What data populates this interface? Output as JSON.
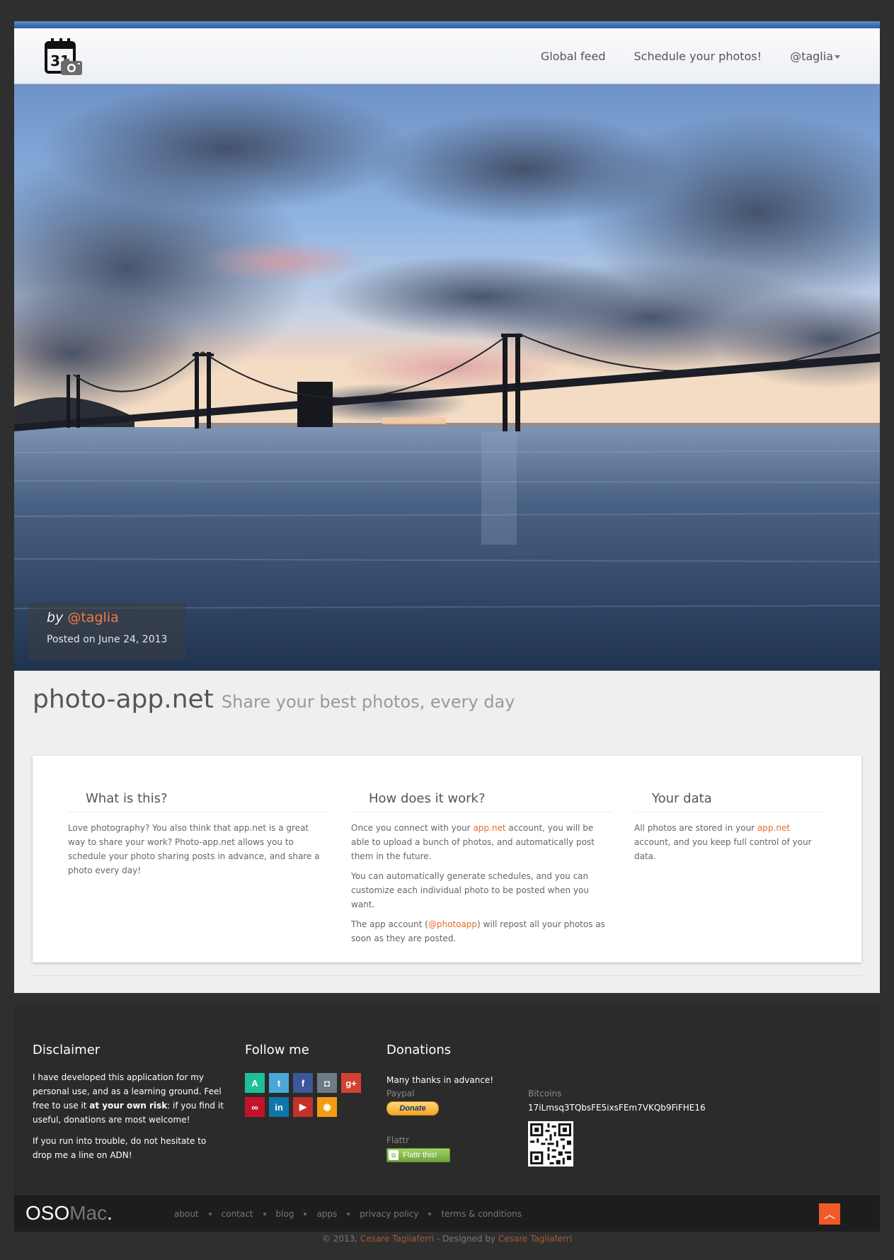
{
  "nav": {
    "items": [
      "Global feed",
      "Schedule your photos!",
      "@taglia"
    ]
  },
  "hero": {
    "by": "by",
    "author": "@taglia",
    "posted": "Posted on June 24, 2013"
  },
  "main": {
    "title": "photo-app.net",
    "tagline": "Share your best photos, every day",
    "columns": [
      {
        "title": "What is this?",
        "p1": "Love photography? You also think that app.net is a great way to share your work? Photo-app.net allows you to schedule your photo sharing posts in advance, and share a photo every day!"
      },
      {
        "title": "How does it work?",
        "p1a": "Once you connect with your ",
        "p1link": "app.net",
        "p1b": " account, you will be able to upload a bunch of photos, and automatically post them in the future.",
        "p2": "You can automatically generate schedules, and you can customize each individual photo to be posted when you want.",
        "p3a": "The app account (",
        "p3link": "@photoapp",
        "p3b": ") will repost all your photos as soon as they are posted."
      },
      {
        "title": "Your data",
        "p1a": "All photos are stored in your ",
        "p1link": "app.net",
        "p1b": " account, and you keep full control of your data."
      }
    ]
  },
  "footer": {
    "disclaimer": {
      "title": "Disclaimer",
      "p1a": "I have developed this application for my personal use, and as a learning ground. Feel free to use it ",
      "p1bold": "at your own risk",
      "p1b": ": if you find it useful, donations are most welcome!",
      "p2": "If you run into trouble, do not hesitate to drop me a line on ADN!"
    },
    "follow": {
      "title": "Follow me",
      "icons": [
        {
          "name": "adn-icon",
          "glyph": "A",
          "color": "#1fbf9a"
        },
        {
          "name": "twitter-icon",
          "glyph": "t",
          "color": "#4aa8d8"
        },
        {
          "name": "facebook-icon",
          "glyph": "f",
          "color": "#3b5998"
        },
        {
          "name": "github-icon",
          "glyph": "◘",
          "color": "#6e7b85"
        },
        {
          "name": "googleplus-icon",
          "glyph": "g+",
          "color": "#d44132"
        },
        {
          "name": "lastfm-icon",
          "glyph": "∞",
          "color": "#c3132a"
        },
        {
          "name": "linkedin-icon",
          "glyph": "in",
          "color": "#0e76a8"
        },
        {
          "name": "youtube-icon",
          "glyph": "▶",
          "color": "#c4302b"
        },
        {
          "name": "rss-icon",
          "glyph": "◉",
          "color": "#f39c12"
        }
      ]
    },
    "donations": {
      "title": "Donations",
      "thanks": "Many thanks in advance!",
      "paypal_label": "Paypal",
      "donate_button": "Donate",
      "flattr_label": "Flattr",
      "flattr_button": "Flattr this!",
      "bitcoins_label": "Bitcoins",
      "bitcoin_address": "17iLmsq3TQbsFE5ixsFEm7VKQb9FiFHE16"
    },
    "brand": {
      "oso": "OSO",
      "mac": "Mac",
      "dot": "."
    },
    "links": [
      "about",
      "contact",
      "blog",
      "apps",
      "privacy policy",
      "terms & conditions"
    ],
    "copyright_a": "© 2013, ",
    "copyright_author1": "Cesare Tagliaferri",
    "copyright_b": " - Designed by ",
    "copyright_author2": "Cesare Tagliaferri"
  },
  "colors": {
    "accent": "#e86b2a",
    "header_bar": "#3f74b8",
    "to_top": "#f05a28"
  }
}
